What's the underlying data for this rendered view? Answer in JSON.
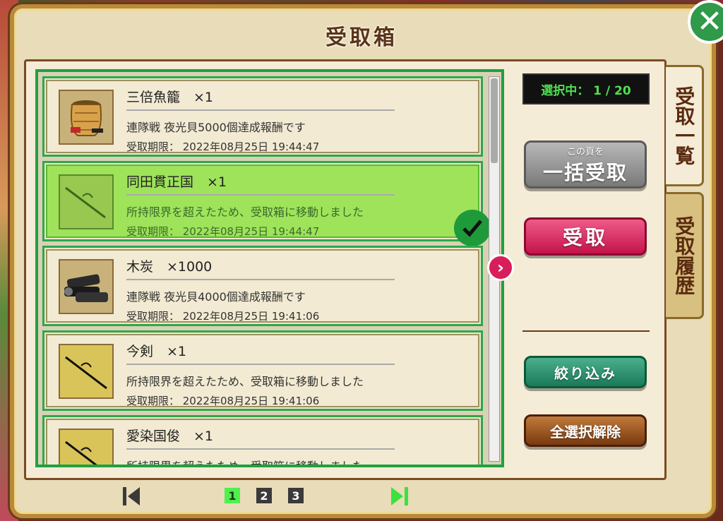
{
  "dialog": {
    "title": "受取箱"
  },
  "items": [
    {
      "name": "三倍魚籠　×1",
      "description": "連隊戦 夜光貝5000個達成報酬です",
      "expiry": "受取期限：  2022年08月25日 19:44:47",
      "icon": "fish-basket-icon",
      "selected": false
    },
    {
      "name": "同田貫正国　×1",
      "description": "所持限界を超えたため、受取箱に移動しました",
      "expiry": "受取期限：  2022年08月25日 19:44:47",
      "icon": "sword-icon",
      "selected": true
    },
    {
      "name": "木炭　×1000",
      "description": "連隊戦 夜光貝4000個達成報酬です",
      "expiry": "受取期限：  2022年08月25日 19:41:06",
      "icon": "charcoal-icon",
      "selected": false
    },
    {
      "name": "今剣　×1",
      "description": "所持限界を超えたため、受取箱に移動しました",
      "expiry": "受取期限：  2022年08月25日 19:41:06",
      "icon": "sword-icon",
      "selected": false
    },
    {
      "name": "愛染国俊　×1",
      "description": "所持限界を超えたため、受取箱に移動しました",
      "expiry": "",
      "icon": "sword-icon",
      "selected": false
    }
  ],
  "side": {
    "selection_counter": "選択中： 1 / 20",
    "bulk_small": "この頁を",
    "bulk_big": "一括受取",
    "receive": "受取",
    "filter": "絞り込み",
    "deselect_all": "全選択解除"
  },
  "tabs": {
    "list": "受取一覧",
    "history": "受取履歴"
  },
  "pagination": {
    "pages": [
      "1",
      "2",
      "3"
    ],
    "current": "1"
  },
  "colors": {
    "accent_green": "#20a040",
    "receive_pink": "#d81e5a"
  }
}
